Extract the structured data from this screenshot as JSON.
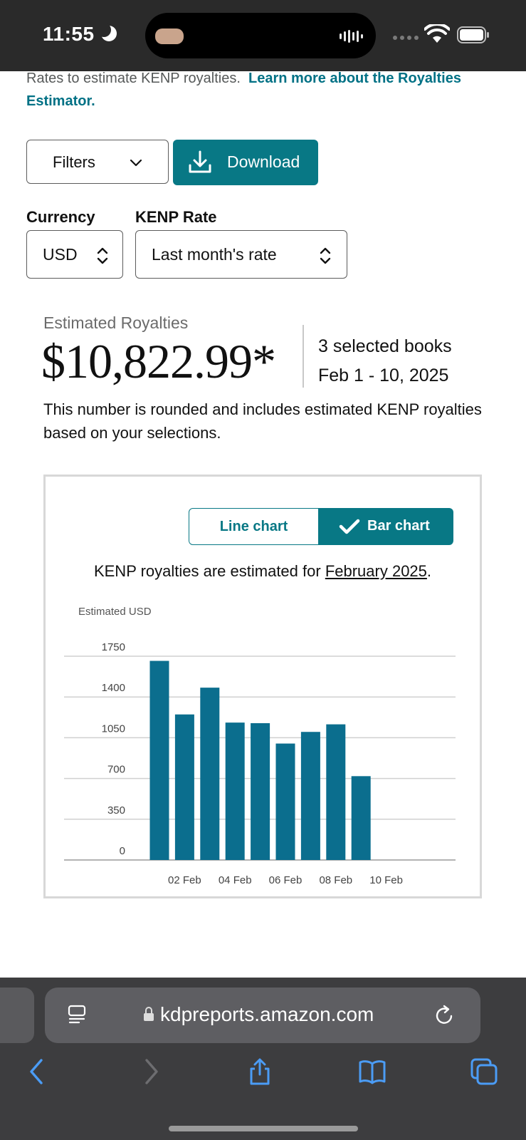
{
  "status_bar": {
    "time": "11:55"
  },
  "page": {
    "intro_text": "Rates to estimate KENP royalties.",
    "intro_link": "Learn more about the Royalties Estimator.",
    "filters_label": "Filters",
    "download_label": "Download",
    "currency": {
      "label": "Currency",
      "value": "USD"
    },
    "kenp_rate": {
      "label": "KENP Rate",
      "value": "Last month's rate"
    },
    "estimated": {
      "label": "Estimated Royalties",
      "amount": "$10,822.99*",
      "books": "3 selected books",
      "dates": "Feb 1 - 10, 2025",
      "note": "This number is rounded and includes estimated KENP royalties based on your selections."
    },
    "chart_toggle": {
      "line": "Line chart",
      "bar": "Bar chart",
      "selected": "Bar chart"
    },
    "kenp_note_prefix": "KENP royalties are estimated for",
    "kenp_note_link": "February 2025",
    "kenp_note_suffix": "."
  },
  "chart_data": {
    "type": "bar",
    "ylabel": "Estimated USD",
    "categories": [
      "01 Feb",
      "02 Feb",
      "03 Feb",
      "04 Feb",
      "05 Feb",
      "06 Feb",
      "07 Feb",
      "08 Feb",
      "09 Feb",
      "10 Feb"
    ],
    "x_tick_labels": [
      "02 Feb",
      "04 Feb",
      "06 Feb",
      "08 Feb",
      "10 Feb"
    ],
    "values": [
      1710,
      1250,
      1480,
      1180,
      1175,
      1000,
      1100,
      1165,
      720,
      0
    ],
    "y_ticks": [
      0,
      350,
      700,
      1050,
      1400,
      1750
    ],
    "ylim": [
      0,
      1750
    ],
    "grid": true,
    "bar_color": "#0b6e8e"
  },
  "browser": {
    "url": "kdpreports.amazon.com"
  },
  "colors": {
    "accent": "#087885",
    "status_bg": "#2a2a2a",
    "browser_bg": "#3d3d3f"
  }
}
